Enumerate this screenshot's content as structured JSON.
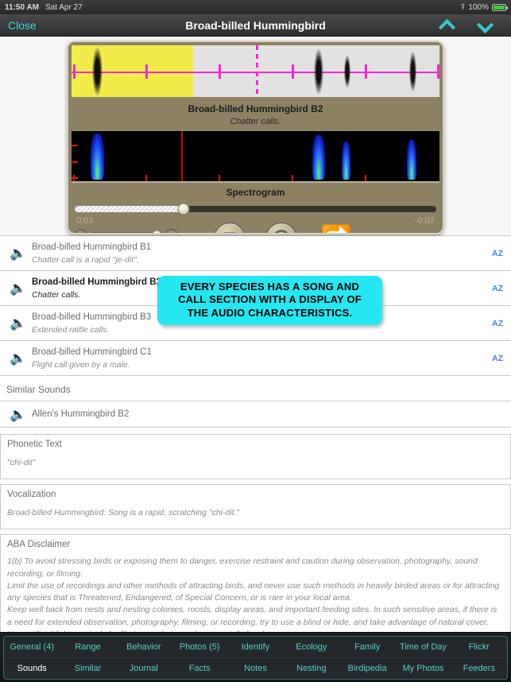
{
  "status_bar": {
    "time": "11:50 AM",
    "date": "Sat Apr 27",
    "wifi_icon": "wifi-icon",
    "battery_percent": "100%"
  },
  "nav": {
    "close_label": "Close",
    "title": "Broad-billed Hummingbird",
    "up_icon": "chevron-up-icon",
    "down_icon": "chevron-down-icon",
    "accent_color": "#35dcd8"
  },
  "player": {
    "title": "Broad-billed Hummingbird B2",
    "subtitle": "Chatter calls.",
    "spectrogram_label": "Spectrogram",
    "elapsed": "0:03",
    "remaining": "-0:07",
    "progress_percent": 30,
    "volume_percent": 95,
    "stop_icon": "stop-button-icon",
    "replay_icon": "replay-button-icon",
    "loop_icon": "loop-repeat-icon",
    "volume_down_icon": "volume-minus-icon",
    "volume_up_icon": "volume-plus-icon",
    "selection_color": "#f2ec4a",
    "waveform_marker_color": "#ff23d6"
  },
  "sounds": {
    "rows": [
      {
        "title": "Broad-billed Hummingbird B1",
        "desc": "Chatter call is a rapid \"je-dit\".",
        "az": "AZ",
        "active": false
      },
      {
        "title": "Broad-billed Hummingbird B2",
        "desc": "Chatter calls.",
        "az": "AZ",
        "active": true
      },
      {
        "title": "Broad-billed Hummingbird B3",
        "desc": "Extended rattle calls.",
        "az": "AZ",
        "active": false
      },
      {
        "title": "Broad-billed Hummingbird C1",
        "desc": "Flight call given by a male.",
        "az": "AZ",
        "active": false
      }
    ]
  },
  "similar": {
    "heading": "Similar Sounds",
    "item_label": "Allen's Hummingbird B2",
    "speaker_icon": "speaker-icon"
  },
  "phonetic": {
    "title": "Phonetic Text",
    "body": "\"chi-dit\""
  },
  "vocalization": {
    "title": "Vocalization",
    "body": "Broad-billed Hummingbird: Song is a rapid, scratching \"chi-dit.\""
  },
  "disclaimer": {
    "title": "ABA Disclaimer",
    "lines": [
      "1(b) To avoid stressing birds or exposing them to danger, exercise restraint and caution during observation, photography, sound recording, or filming.",
      "Limit the use of recordings and other methods of attracting birds, and never use such methods in heavily birded areas or for attracting any species that is Threatened, Endangered, of Special Concern, or is rare in your local area.",
      "Keep well back from nests and nesting colonies, roosts, display areas, and important feeding sites. In such sensitive areas, if there is a need for extended observation, photography, filming, or recording, try to use a blind or hide, and take advantage of natural cover.",
      "Use artificial light sparingly for filming or photography, especially for close-ups."
    ]
  },
  "callout": {
    "lines": [
      "EVERY SPECIES HAS A SONG AND",
      "CALL SECTION WITH A DISPLAY OF",
      "THE AUDIO CHARACTERISTICS."
    ],
    "background_color": "#24e7f2"
  },
  "tabbar": {
    "row1": [
      "General (4)",
      "Range",
      "Behavior",
      "Photos (5)",
      "Identify",
      "Ecology",
      "Family",
      "Time of Day",
      "Flickr"
    ],
    "row2": [
      "Sounds",
      "Similar",
      "Journal",
      "Facts",
      "Notes",
      "Nesting",
      "Birdipedia",
      "My Photos",
      "Feeders"
    ],
    "active": "Sounds",
    "accent_color": "#4fd0c8"
  }
}
